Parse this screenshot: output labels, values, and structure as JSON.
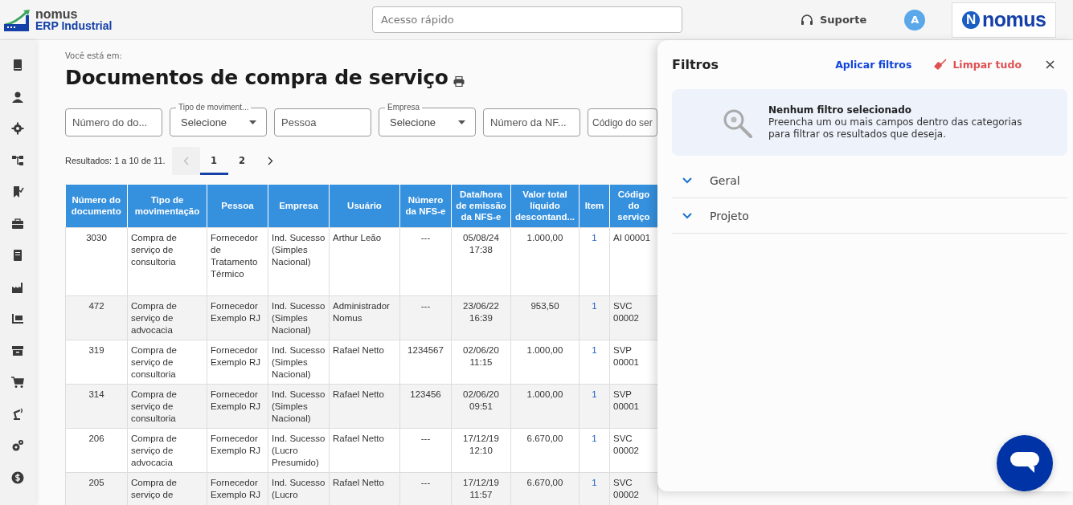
{
  "header": {
    "logo": {
      "brand": "nomus",
      "product": "ERP Industrial"
    },
    "search": {
      "placeholder": "Acesso rápido"
    },
    "support": "Suporte",
    "avatar": "A",
    "brand_logo": {
      "mark": "N",
      "text": "nomus"
    }
  },
  "breadcrumb": "Você está em:",
  "title": "Documentos de compra de serviço",
  "filters": [
    {
      "kind": "input",
      "placeholder": "Número do do..."
    },
    {
      "kind": "select",
      "label": "Tipo de moviment...",
      "value": "Selecione"
    },
    {
      "kind": "input",
      "placeholder": "Pessoa"
    },
    {
      "kind": "select",
      "label": "Empresa",
      "value": "Selecione"
    },
    {
      "kind": "input",
      "placeholder": "Número da NF..."
    },
    {
      "kind": "input",
      "placeholder": "Código do ser"
    }
  ],
  "results": "Resultados: 1 a 10 de 11.",
  "pagination": {
    "prev_disabled": true,
    "pages": [
      {
        "label": "1",
        "selected": true
      },
      {
        "label": "2",
        "selected": false
      }
    ]
  },
  "table": {
    "columns": [
      "Número do documento",
      "Tipo de movimentação",
      "Pessoa",
      "Empresa",
      "Usuário",
      "Número da NFS-e",
      "Data/hora de emissão da NFS-e",
      "Valor total líquido descontand...",
      "Item",
      "Código do serviço"
    ],
    "rows": [
      [
        "3030",
        "Compra de serviço de consultoria",
        "Fornecedor de Tratamento Térmico",
        "Ind. Sucesso (Simples Nacional)",
        "Arthur Leão",
        "---",
        "05/08/24 17:38",
        "1.000,00",
        "1",
        "AI 00001"
      ],
      [
        "472",
        "Compra de serviço de advocacia",
        "Fornecedor Exemplo RJ",
        "Ind. Sucesso (Simples Nacional)",
        "Administrador Nomus",
        "---",
        "23/06/22 16:39",
        "953,50",
        "1",
        "SVC 00002"
      ],
      [
        "319",
        "Compra de serviço de consultoria",
        "Fornecedor Exemplo RJ",
        "Ind. Sucesso (Simples Nacional)",
        "Rafael Netto",
        "1234567",
        "02/06/20 11:15",
        "1.000,00",
        "1",
        "SVP 00001"
      ],
      [
        "314",
        "Compra de serviço de consultoria",
        "Fornecedor Exemplo RJ",
        "Ind. Sucesso (Simples Nacional)",
        "Rafael Netto",
        "123456",
        "02/06/20 09:51",
        "1.000,00",
        "1",
        "SVP 00001"
      ],
      [
        "206",
        "Compra de serviço de advocacia",
        "Fornecedor Exemplo RJ",
        "Ind. Sucesso (Lucro Presumido)",
        "Rafael Netto",
        "---",
        "17/12/19 12:10",
        "6.670,00",
        "1",
        "SVC 00002"
      ],
      [
        "205",
        "Compra de serviço de",
        "Fornecedor Exemplo RJ",
        "Ind. Sucesso (Lucro",
        "Rafael Netto",
        "---",
        "17/12/19 11:57",
        "6.670,00",
        "1",
        "SVC 00002"
      ]
    ]
  },
  "filter_panel": {
    "title": "Filtros",
    "apply": "Aplicar filtros",
    "clear": "Limpar tudo",
    "empty_title": "Nenhum filtro selecionado",
    "empty_text": "Preencha um ou mais campos dentro das categorias para filtrar os resultados que deseja.",
    "sections": [
      {
        "label": "Geral",
        "expanded": false
      },
      {
        "label": "Projeto",
        "expanded": false
      }
    ]
  }
}
